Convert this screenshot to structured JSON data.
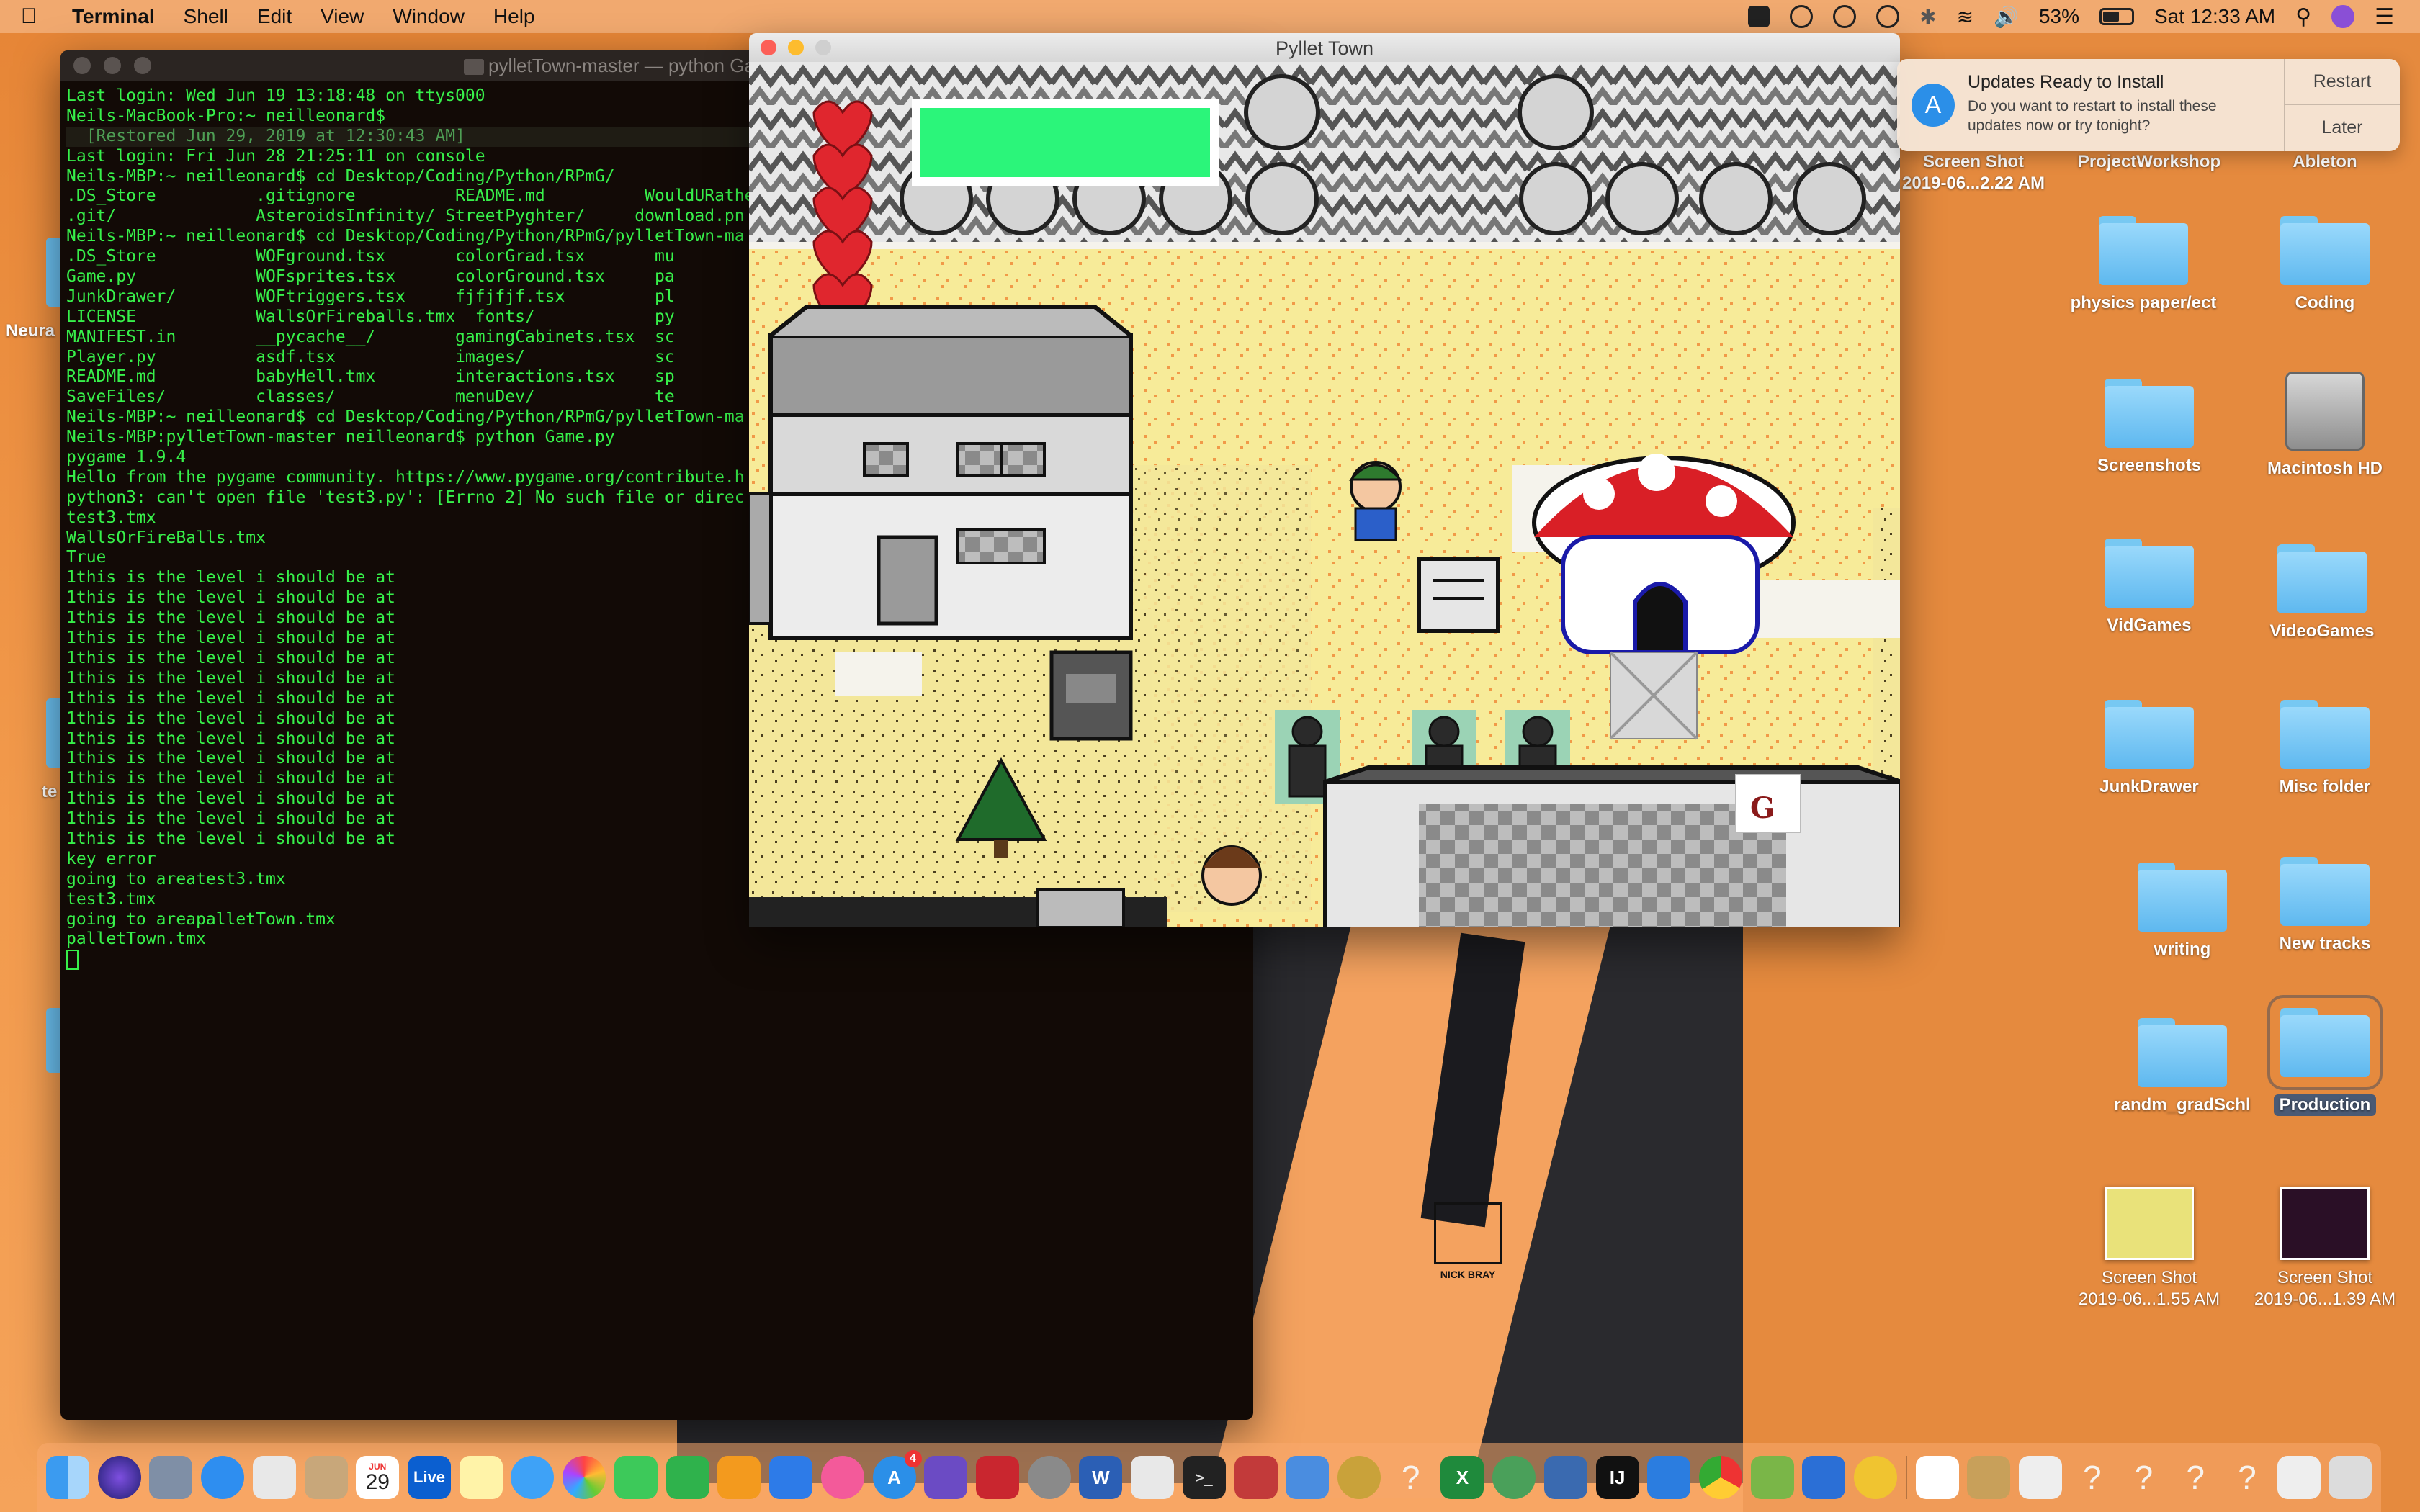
{
  "menubar": {
    "app": "Terminal",
    "items": [
      "Shell",
      "Edit",
      "View",
      "Window",
      "Help"
    ],
    "battery": "53%",
    "datetime": "Sat 12:33 AM"
  },
  "terminal": {
    "title": "pylletTown-master — python Gar",
    "lines": [
      "Last login: Wed Jun 19 13:18:48 on ttys000",
      "Neils-MacBook-Pro:~ neilleonard$",
      "  [Restored Jun 29, 2019 at 12:30:43 AM]",
      "Last login: Fri Jun 28 21:25:11 on console",
      "Neils-MBP:~ neilleonard$ cd Desktop/Coding/Python/RPmG/",
      ".DS_Store          .gitignore          README.md          WouldURathe",
      ".git/              AsteroidsInfinity/ StreetPyghter/     download.pn",
      "Neils-MBP:~ neilleonard$ cd Desktop/Coding/Python/RPmG/pylletTown-ma",
      ".DS_Store          WOFground.tsx       colorGrad.tsx       mu",
      "Game.py            WOFsprites.tsx      colorGround.tsx     pa",
      "JunkDrawer/        WOFtriggers.tsx     fjfjfjf.tsx         pl",
      "LICENSE            WallsOrFireballs.tmx  fonts/            py",
      "MANIFEST.in        __pycache__/        gamingCabinets.tsx  sc",
      "Player.py          asdf.tsx            images/             sc",
      "README.md          babyHell.tmx        interactions.tsx    sp",
      "SaveFiles/         classes/            menuDev/            te",
      "Neils-MBP:~ neilleonard$ cd Desktop/Coding/Python/RPmG/pylletTown-ma",
      "Neils-MBP:pylletTown-master neilleonard$ python Game.py",
      "pygame 1.9.4",
      "Hello from the pygame community. https://www.pygame.org/contribute.h",
      "python3: can't open file 'test3.py': [Errno 2] No such file or direc",
      "test3.tmx",
      "WallsOrFireBalls.tmx",
      "True",
      "1this is the level i should be at",
      "1this is the level i should be at",
      "1this is the level i should be at",
      "1this is the level i should be at",
      "1this is the level i should be at",
      "1this is the level i should be at",
      "1this is the level i should be at",
      "1this is the level i should be at",
      "1this is the level i should be at",
      "1this is the level i should be at",
      "1this is the level i should be at",
      "1this is the level i should be at",
      "1this is the level i should be at",
      "1this is the level i should be at",
      "key error",
      "going to areatest3.tmx",
      "test3.tmx",
      "going to areapalletTown.tmx",
      "palletTown.tmx"
    ]
  },
  "game": {
    "title": "Pyllet Town",
    "health_color": "#2bf57a",
    "heart_color": "#e0262e"
  },
  "notification": {
    "title": "Updates Ready to Install",
    "body": "Do you want to restart to install these updates now or try tonight?",
    "restart": "Restart",
    "later": "Later"
  },
  "desktop": {
    "partial_left_1": "Neura",
    "partial_left_2": "te",
    "wallpaper_logo": "NICK BRAY",
    "icons": [
      {
        "label": "Screen Shot\n2019-06...2.22 AM",
        "kind": "plain"
      },
      {
        "label": "ProjectWorkshop",
        "kind": "plain"
      },
      {
        "label": "Ableton",
        "kind": "plain"
      },
      {
        "label": "physics paper/ect",
        "kind": "folder"
      },
      {
        "label": "Coding",
        "kind": "folder"
      },
      {
        "label": "Screenshots",
        "kind": "folder"
      },
      {
        "label": "Macintosh HD",
        "kind": "hdd"
      },
      {
        "label": "VidGames",
        "kind": "folder"
      },
      {
        "label": "VideoGames",
        "kind": "folder"
      },
      {
        "label": "JunkDrawer",
        "kind": "folder"
      },
      {
        "label": "Misc folder",
        "kind": "folder"
      },
      {
        "label": "writing",
        "kind": "folder"
      },
      {
        "label": "New tracks",
        "kind": "folder"
      },
      {
        "label": "randm_gradSchl",
        "kind": "folder"
      },
      {
        "label": "Production",
        "kind": "folder"
      },
      {
        "label": "Screen Shot\n2019-06...1.55 AM",
        "kind": "shot"
      },
      {
        "label": "Screen Shot\n2019-06...1.39 AM",
        "kind": "shot"
      }
    ]
  },
  "dock": {
    "calendar_day": "29",
    "calendar_month": "JUN",
    "live_label": "Live",
    "word_label": "W",
    "ij_label": "IJ",
    "badge": "4"
  }
}
